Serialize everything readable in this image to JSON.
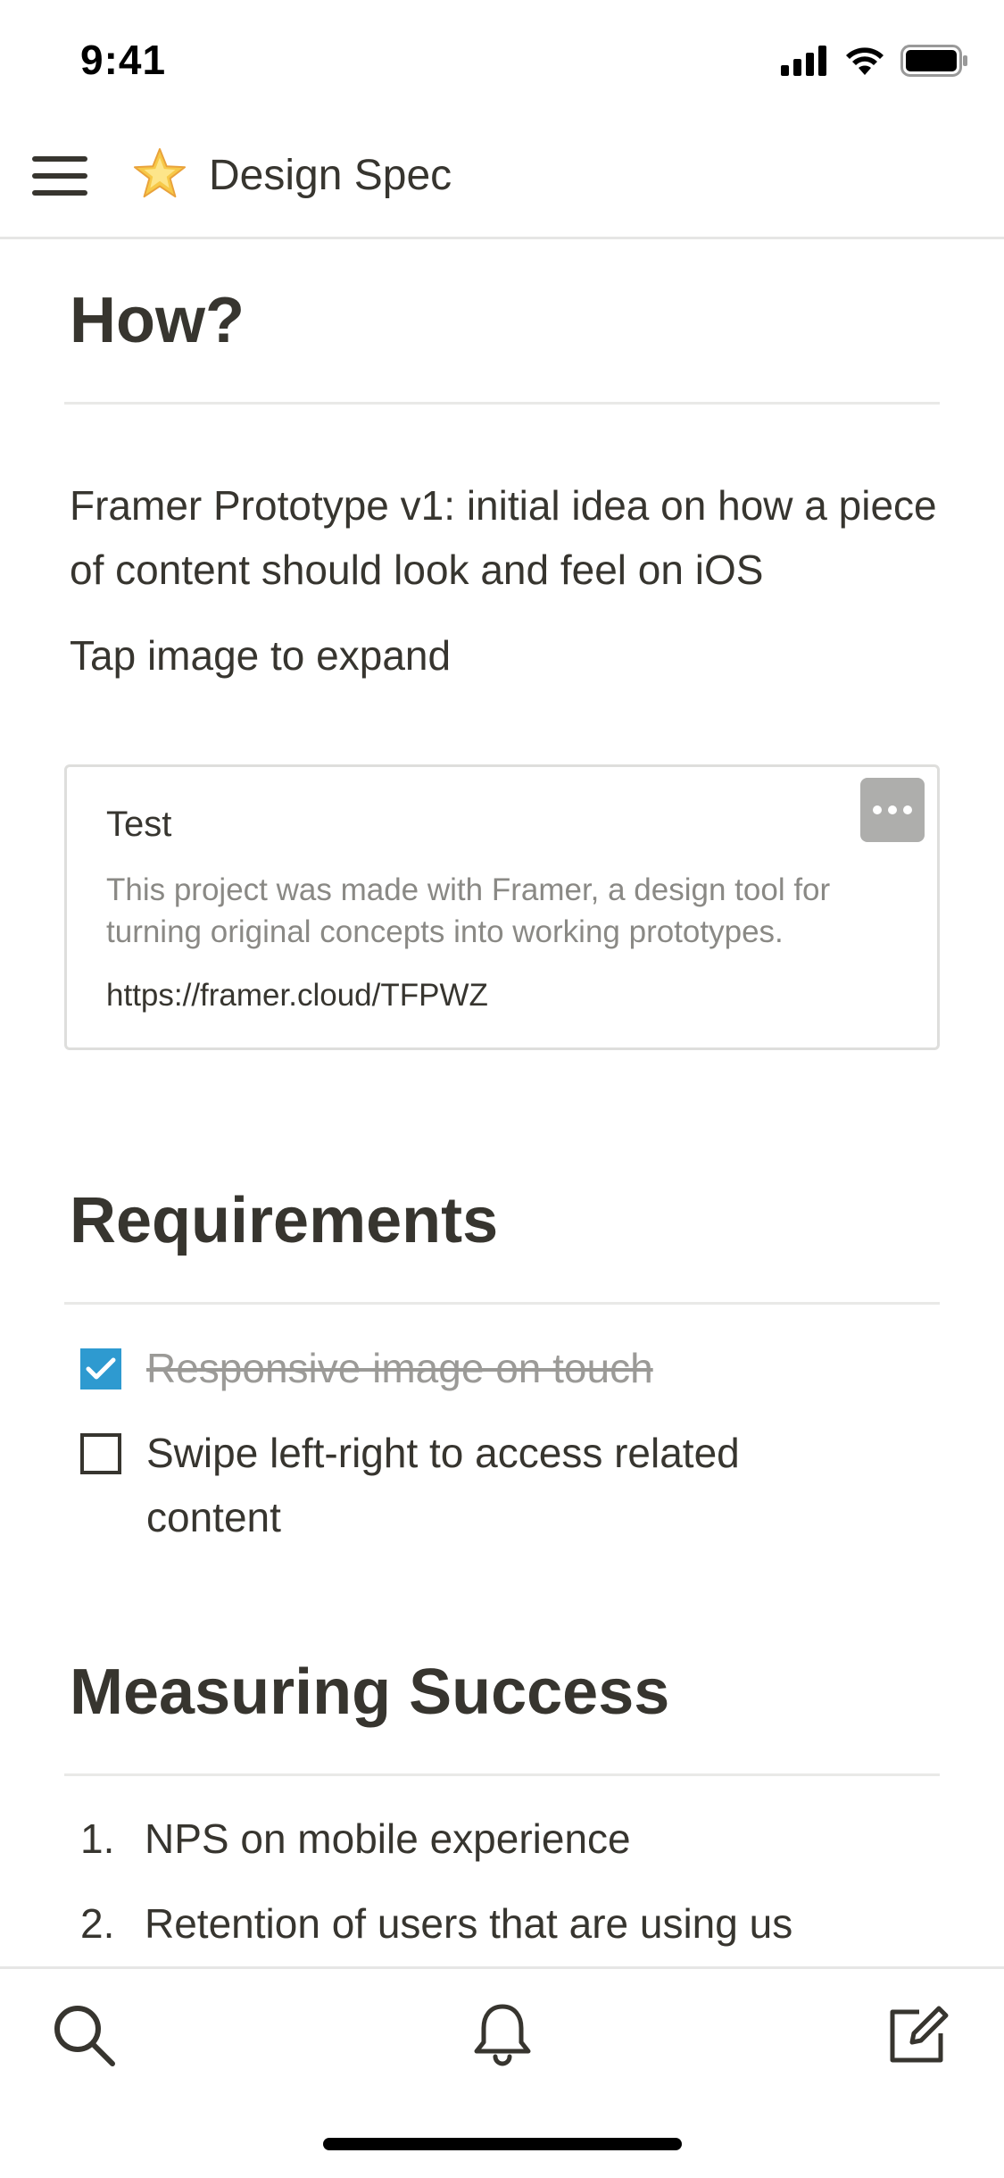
{
  "status_bar": {
    "time": "9:41"
  },
  "header": {
    "page_emoji": "star-icon",
    "title": "Design Spec"
  },
  "sections": {
    "how": {
      "heading": "How?",
      "paragraph": "Framer Prototype v1: initial idea on how a piece of content should look and feel on iOS",
      "hint": "Tap image to expand"
    },
    "embed": {
      "title": "Test",
      "description": "This project was made with Framer, a design tool for turning original concepts into working prototypes.",
      "url": "https://framer.cloud/TFPWZ"
    },
    "requirements": {
      "heading": "Requirements",
      "todos": [
        {
          "text": "Responsive image on touch",
          "checked": true
        },
        {
          "text": "Swipe left-right to access related content",
          "checked": false
        }
      ]
    },
    "measuring": {
      "heading": "Measuring Success",
      "items": [
        {
          "num": "1.",
          "text": "NPS on mobile experience"
        },
        {
          "num": "2.",
          "text": "Retention of users that are using us"
        }
      ]
    }
  },
  "tab_bar": {
    "icons": [
      "search-icon",
      "bell-icon",
      "compose-icon"
    ]
  },
  "colors": {
    "accent": "#2e9ad0",
    "text": "#37352f",
    "muted": "#9b9a97"
  }
}
